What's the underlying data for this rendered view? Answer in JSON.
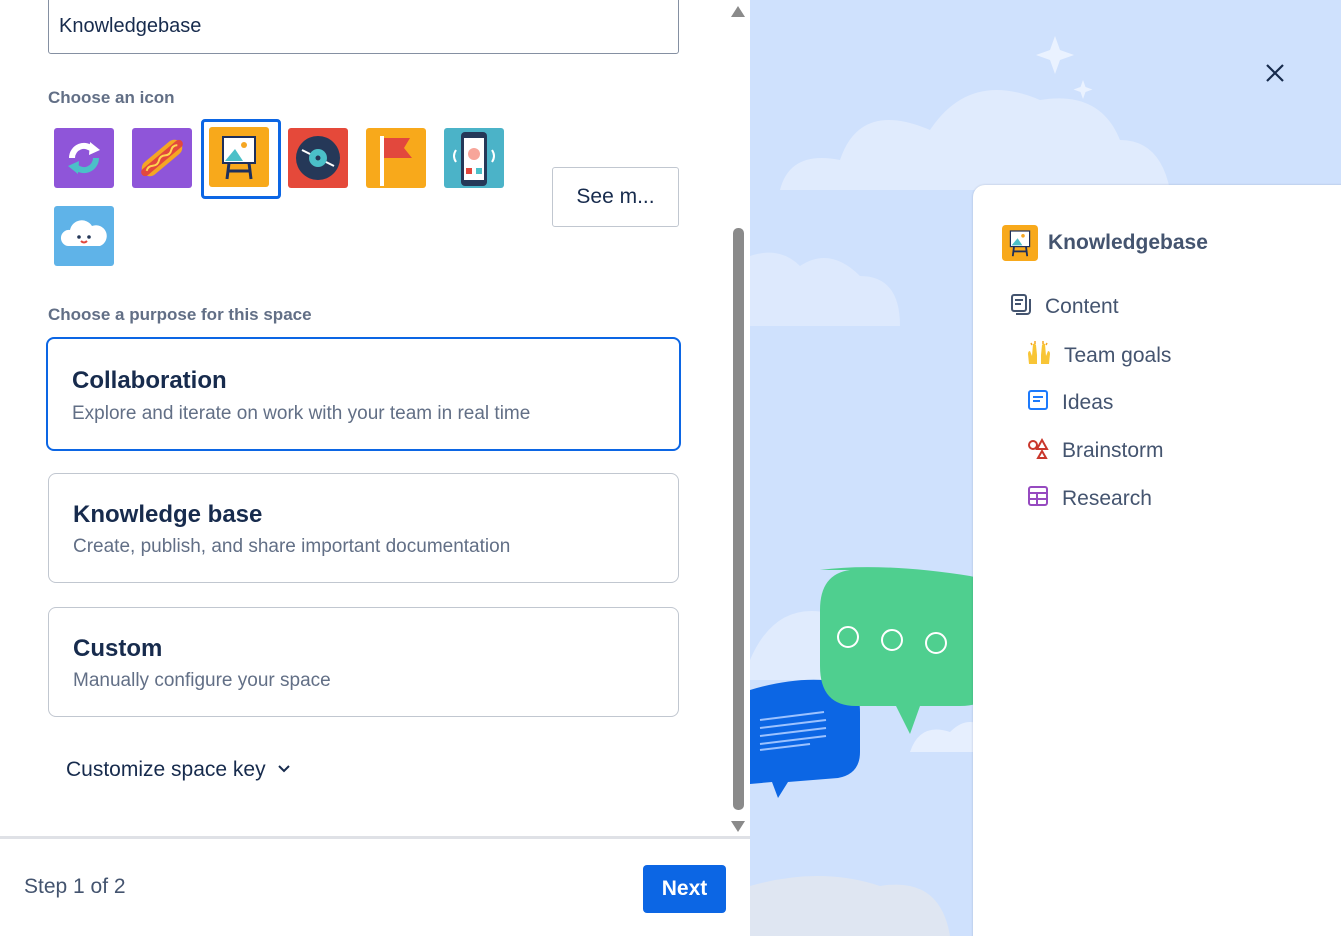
{
  "form": {
    "space_name_value": "Knowledgebase",
    "choose_icon_label": "Choose an icon",
    "see_more_label": "See m...",
    "choose_purpose_label": "Choose a purpose for this space",
    "purposes": [
      {
        "title": "Collaboration",
        "description": "Explore and iterate on work with your team in real time",
        "selected": true
      },
      {
        "title": "Knowledge base",
        "description": "Create, publish, and share important documentation",
        "selected": false
      },
      {
        "title": "Custom",
        "description": "Manually configure your space",
        "selected": false
      }
    ],
    "customize_key_label": "Customize space key"
  },
  "icons": [
    "sync-icon",
    "hotdog-icon",
    "easel-picture-icon",
    "vinyl-record-icon",
    "red-flag-icon",
    "phone-character-icon",
    "cloud-face-icon"
  ],
  "selected_icon": "easel-picture-icon",
  "footer": {
    "step_text": "Step 1 of 2",
    "next_label": "Next"
  },
  "preview": {
    "space_title": "Knowledgebase",
    "items": [
      {
        "label": "Content",
        "icon": "content-pages-icon"
      },
      {
        "label": "Team goals",
        "icon": "raised-hands-emoji-icon"
      },
      {
        "label": "Ideas",
        "icon": "page-icon"
      },
      {
        "label": "Brainstorm",
        "icon": "whiteboard-shapes-icon"
      },
      {
        "label": "Research",
        "icon": "database-table-icon"
      }
    ]
  },
  "colors": {
    "accent": "#0c66e4",
    "preview_background": "#cfe1fd",
    "speech_bubble_green": "#4cd08f",
    "speech_bubble_blue": "#0c66e4"
  }
}
